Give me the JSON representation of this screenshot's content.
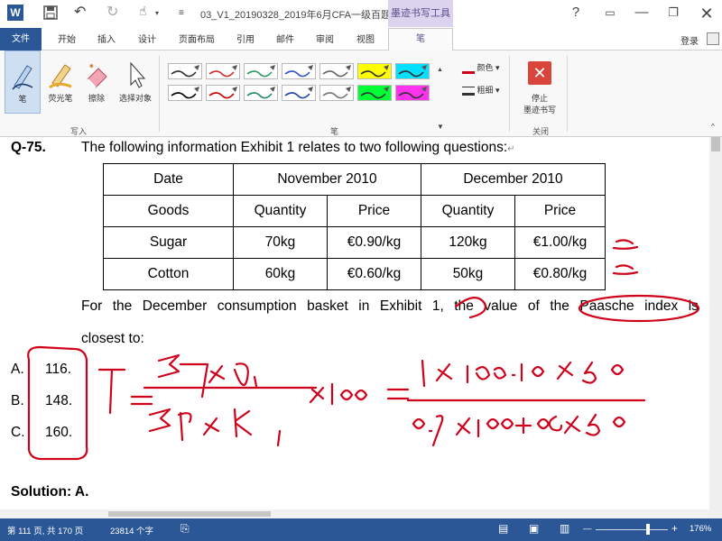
{
  "window": {
    "doc_title": "03_V1_20190328_2019年6月CFA一级百题预...",
    "context_tab_title": "墨迹书写工具",
    "help": "?",
    "minimize": "—",
    "restore": "❐",
    "close": "✕"
  },
  "quick_access": {
    "word_icon": "W",
    "save_icon": "💾",
    "undo_icon": "↶",
    "redo_icon": "↻",
    "touch_icon": "☝"
  },
  "tabs": [
    "文件",
    "开始",
    "插入",
    "设计",
    "页面布局",
    "引用",
    "邮件",
    "审阅",
    "视图",
    "笔"
  ],
  "login": "登录",
  "ribbon": {
    "write_tools": [
      {
        "name": "pen-tool",
        "label": "笔",
        "icon": "pen-icon"
      },
      {
        "name": "highlighter-tool",
        "label": "荧光笔",
        "icon": "highlighter-icon"
      },
      {
        "name": "eraser-tool",
        "label": "擦除",
        "icon": "eraser-icon"
      },
      {
        "name": "select-objects-tool",
        "label": "选择对象",
        "icon": "pointer-icon"
      }
    ],
    "write_group_label": "写入",
    "pen_group_label": "笔",
    "close_group_label": "关闭",
    "color_label": "颜色",
    "weight_label": "粗细",
    "stop_label_line1": "停止",
    "stop_label_line2": "墨迹书写",
    "pen_swatches": [
      {
        "color": "#333333",
        "bg": "#ffffff"
      },
      {
        "color": "#cc3333",
        "bg": "#ffffff"
      },
      {
        "color": "#339966",
        "bg": "#ffffff"
      },
      {
        "color": "#3355cc",
        "bg": "#ffffff"
      },
      {
        "color": "#666666",
        "bg": "#ffffff"
      },
      {
        "color": "#333333",
        "bg": "#ffff00"
      },
      {
        "color": "#333333",
        "bg": "#00e0ff"
      },
      {
        "color": "#000000",
        "bg": "#ffffff"
      },
      {
        "color": "#cc0000",
        "bg": "#ffffff"
      },
      {
        "color": "#2b8a6e",
        "bg": "#ffffff"
      },
      {
        "color": "#2244aa",
        "bg": "#ffffff"
      },
      {
        "color": "#777777",
        "bg": "#ffffff"
      },
      {
        "color": "#333333",
        "bg": "#00ff33"
      },
      {
        "color": "#333333",
        "bg": "#ff33ee"
      }
    ]
  },
  "document": {
    "q_number": "Q-75.",
    "intro": "The following information Exhibit 1 relates to two following questions:",
    "table": {
      "header1": [
        "Date",
        "November 2010",
        "December 2010"
      ],
      "header2": [
        "Goods",
        "Quantity",
        "Price",
        "Quantity",
        "Price"
      ],
      "rows": [
        [
          "Sugar",
          "70kg",
          "€0.90/kg",
          "120kg",
          "€1.00/kg"
        ],
        [
          "Cotton",
          "60kg",
          "€0.60/kg",
          "50kg",
          "€0.80/kg"
        ]
      ]
    },
    "para_line1_words": [
      "For",
      "the",
      "December",
      "consumption",
      "basket",
      "in",
      "Exhibit",
      "1,",
      "the",
      "value",
      "of",
      "the",
      "Paasche",
      "index",
      "is"
    ],
    "para_line2": "closest to:",
    "options": [
      {
        "letter": "A.",
        "value": "116."
      },
      {
        "letter": "B.",
        "value": "148."
      },
      {
        "letter": "C.",
        "value": "160."
      }
    ],
    "solution": "Solution: A."
  },
  "status": {
    "page": "第 111 页, 共 170 页",
    "words": "23814 个字",
    "zoom": "176%",
    "zoom_minus": "—",
    "zoom_plus": "+",
    "zoom_slider_level": 0.72
  },
  "colors": {
    "accent": "#2b5797",
    "ink": "#d0021b",
    "context": "#5a4b8a"
  }
}
